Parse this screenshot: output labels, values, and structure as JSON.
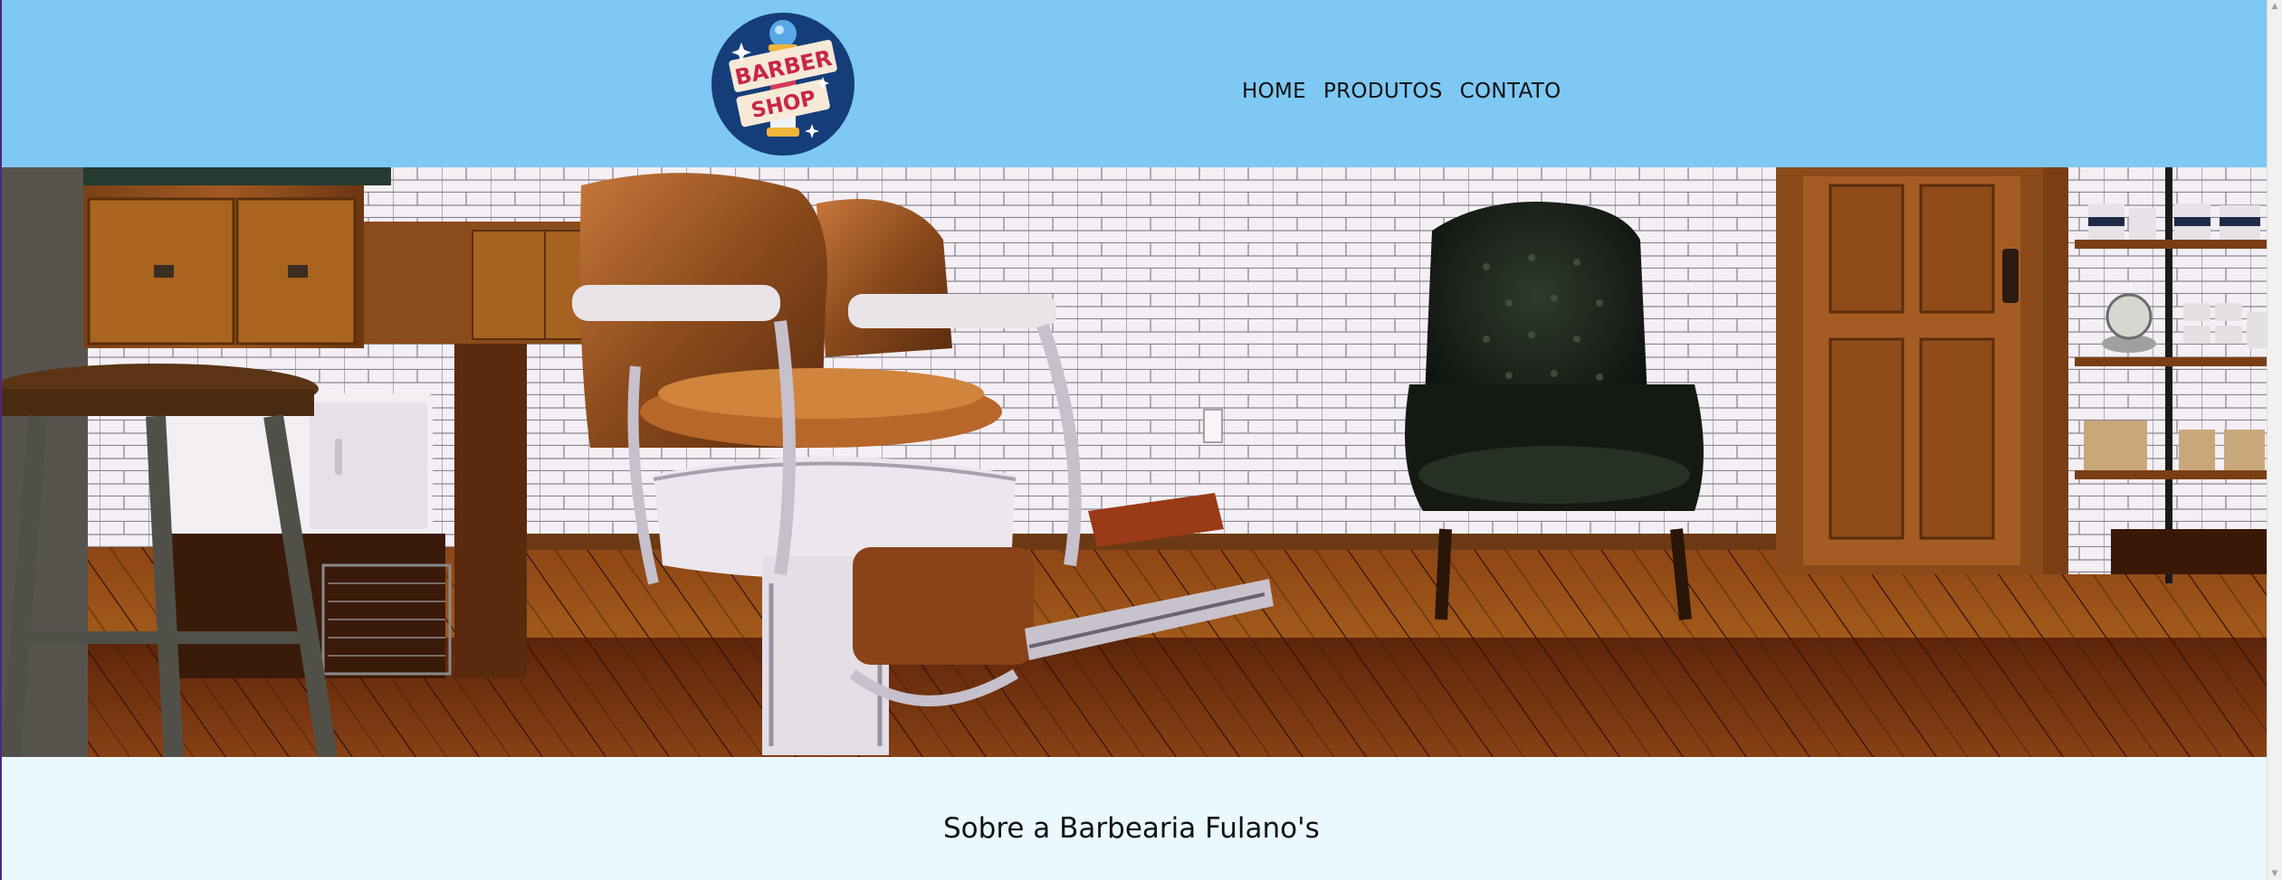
{
  "logo": {
    "line1": "BARBER",
    "line2": "SHOP"
  },
  "nav": {
    "items": [
      {
        "label": "HOME"
      },
      {
        "label": "PRODUTOS"
      },
      {
        "label": "CONTATO"
      }
    ]
  },
  "about": {
    "title": "Sobre a Barbearia Fulano's"
  },
  "colors": {
    "header_bg": "#7ec8f4",
    "page_bg": "#eaf8ff",
    "logo_circle": "#143d7a",
    "logo_ribbon": "#f6e9d6",
    "logo_text": "#c8264a"
  }
}
